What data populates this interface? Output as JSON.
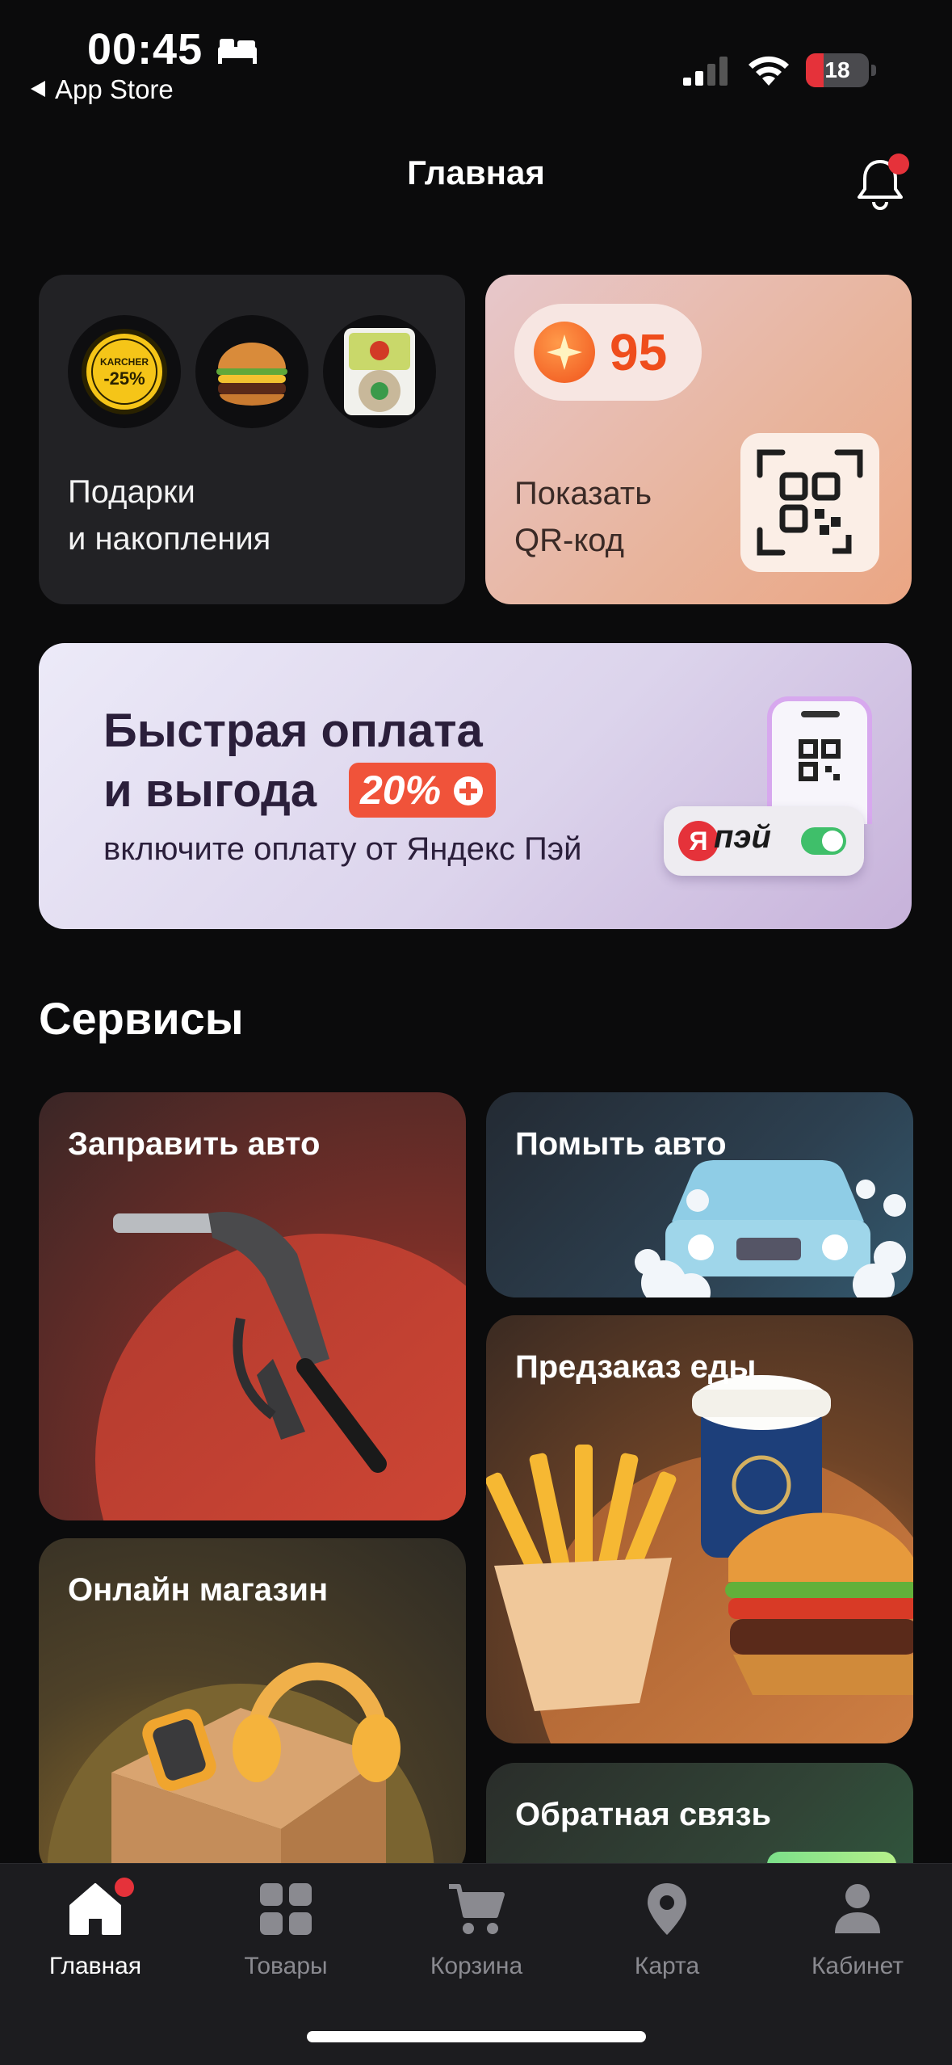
{
  "status_bar": {
    "time": "00:45",
    "back_app": "App Store",
    "battery": "18"
  },
  "header": {
    "title": "Главная"
  },
  "gifts_card": {
    "label_line1": "Подарки",
    "label_line2": "и накопления",
    "thumbnails": [
      "karcher-coupon",
      "burger",
      "salad-box"
    ],
    "karcher_brand": "KARCHER",
    "karcher_discount": "-25%"
  },
  "qr_card": {
    "points": "95",
    "label_line1": "Показать",
    "label_line2": "QR-код"
  },
  "banner": {
    "title_line1": "Быстрая оплата",
    "title_line2": "и выгода",
    "badge": "20%",
    "subtitle": "включите оплату от Яндекс Пэй",
    "pay_letter": "Я",
    "pay_logo": "пэй"
  },
  "services": {
    "title": "Сервисы",
    "items": [
      {
        "label": "Заправить авто"
      },
      {
        "label": "Помыть авто"
      },
      {
        "label": "Предзаказ еды"
      },
      {
        "label": "Онлайн магазин"
      },
      {
        "label": "Обратная связь"
      }
    ]
  },
  "tabbar": {
    "items": [
      {
        "label": "Главная",
        "icon": "home-icon",
        "active": true
      },
      {
        "label": "Товары",
        "icon": "grid-icon"
      },
      {
        "label": "Корзина",
        "icon": "cart-icon"
      },
      {
        "label": "Карта",
        "icon": "map-pin-icon"
      },
      {
        "label": "Кабинет",
        "icon": "profile-icon"
      }
    ]
  },
  "colors": {
    "background": "#0b0b0c",
    "accent_red": "#e5323a",
    "points_orange": "#ef4d1c",
    "tab_inactive": "#8a8a90"
  }
}
